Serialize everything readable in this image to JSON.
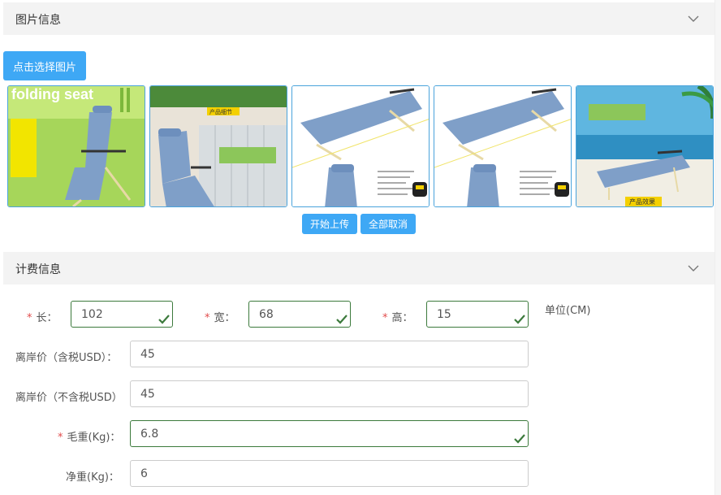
{
  "image_section": {
    "title": "图片信息",
    "select_button": "点击选择图片",
    "thumbnails": [
      {
        "text": "folding seat"
      },
      {
        "text": "产品细节"
      },
      {
        "text": ""
      },
      {
        "text": ""
      },
      {
        "text": "产品效果"
      }
    ],
    "upload_button": "开始上传",
    "cancel_all_button": "全部取消"
  },
  "billing_section": {
    "title": "计费信息",
    "length_label": "长：",
    "length_value": "102",
    "width_label": "宽：",
    "width_value": "68",
    "height_label": "高：",
    "height_value": "15",
    "unit_label": "单位(CM)",
    "price_tax_label": "离岸价（含税USD）：",
    "price_tax_value": "45",
    "price_notax_label": "离岸价（不含税USD）",
    "price_notax_value": "45",
    "gross_weight_label": "毛重(Kg)：",
    "gross_weight_value": "6.8",
    "net_weight_label": "净重(Kg)：",
    "net_weight_value": "6"
  },
  "colors": {
    "accent": "#3ea8f5",
    "valid": "#3c7a3c",
    "required": "#e14b4b"
  }
}
